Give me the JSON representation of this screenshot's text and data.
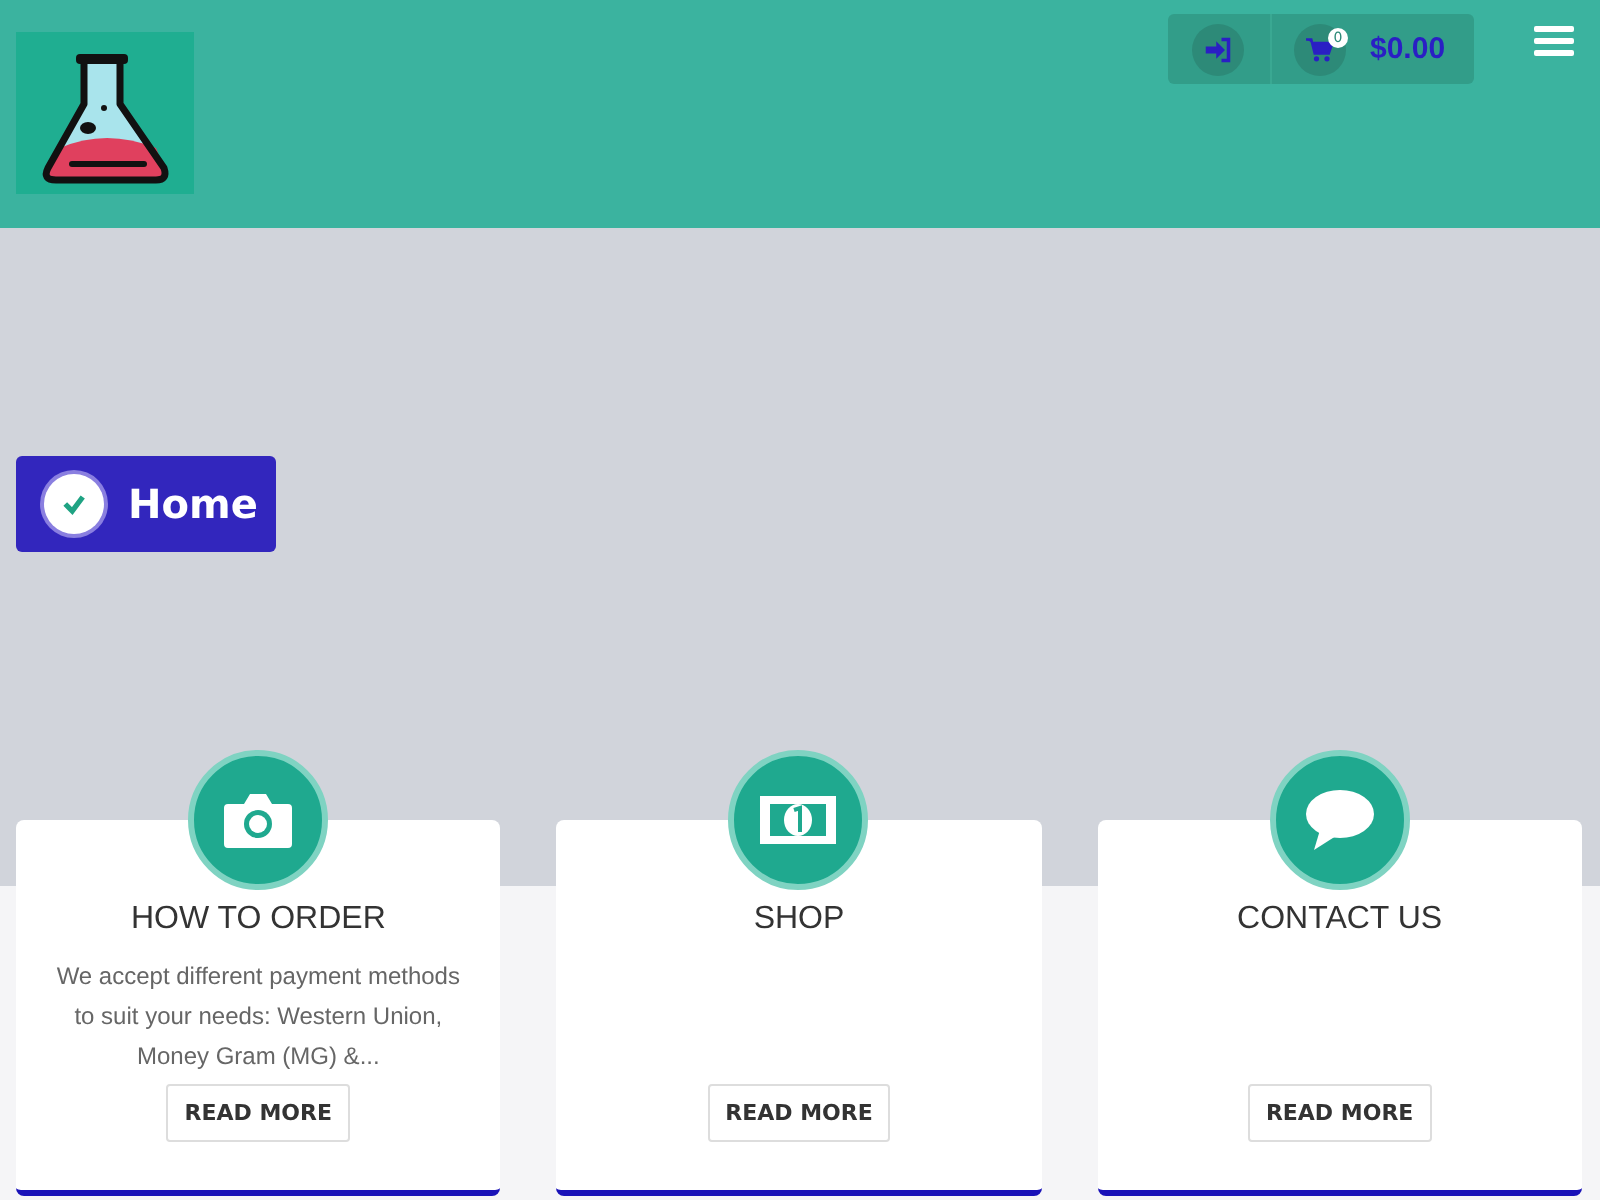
{
  "header": {
    "cart": {
      "count": "0",
      "total": "$0.00"
    }
  },
  "page_title": "Home",
  "cards": [
    {
      "title": "HOW TO ORDER",
      "text": "We accept different payment methods to suit your needs: Western Union, Money Gram (MG) &...",
      "button": "READ MORE"
    },
    {
      "title": "SHOP",
      "button": "READ MORE"
    },
    {
      "title": "CONTACT US",
      "button": "READ MORE"
    }
  ]
}
